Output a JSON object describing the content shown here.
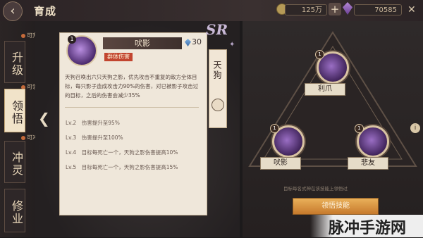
{
  "header": {
    "title": "育成",
    "coins": "125万",
    "gems": "70585"
  },
  "sidebar": {
    "tabs": [
      {
        "label": "升级",
        "hint": "可升级"
      },
      {
        "label": "领悟",
        "hint": "可领悟"
      },
      {
        "label": "冲灵",
        "hint": "可冲灵"
      },
      {
        "label": "修业"
      }
    ]
  },
  "skill": {
    "badge": "1",
    "name": "吠影",
    "cost": "30",
    "tag": "群体伤害",
    "description": "天狗召唤出六只天狗之影，优先攻击不重复的敌方全体目标，每只影子造成攻击力90%的伤害，对已被影子攻击过的目标，之后的伤害会减少35%",
    "levels": [
      "Lv.2　伤害提升至95%",
      "Lv.3　伤害提升至100%",
      "Lv.4　目标每死亡一个，天狗之影伤害提高10%",
      "Lv.5　目标每死亡一个，天狗之影伤害提高15%"
    ]
  },
  "shikigami": {
    "rarity": "SR",
    "name": "天狗"
  },
  "skill_tree": {
    "nodes": [
      {
        "label": "利爪",
        "badge": "1"
      },
      {
        "label": "吠影",
        "badge": "1"
      },
      {
        "label": "悲友",
        "badge": "1"
      }
    ],
    "note": "目标每名式神在该技能上领悟过",
    "button": "领悟技能"
  },
  "watermark": "脉冲手游网",
  "colors": {
    "accent": "#c2452f",
    "panel": "#efe7da",
    "button": "#d98a36"
  }
}
